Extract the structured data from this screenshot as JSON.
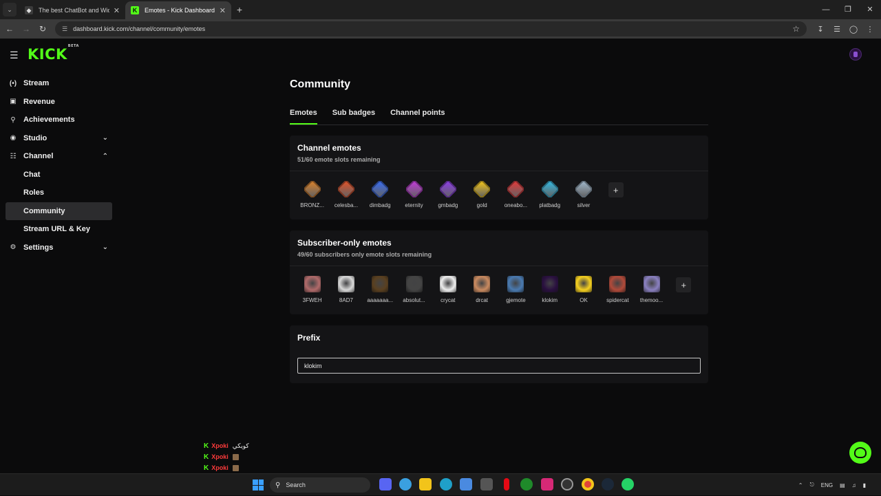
{
  "browser": {
    "tabs": [
      {
        "title": "The best ChatBot and Widgets",
        "active": false
      },
      {
        "title": "Emotes - Kick Dashboard",
        "active": true
      }
    ],
    "url": "dashboard.kick.com/channel/community/emotes"
  },
  "app": {
    "logo": "KICK",
    "logo_badge": "BETA"
  },
  "sidebar": {
    "items": [
      {
        "label": "Stream",
        "icon": "broadcast-icon"
      },
      {
        "label": "Revenue",
        "icon": "revenue-icon"
      },
      {
        "label": "Achievements",
        "icon": "trophy-icon"
      },
      {
        "label": "Studio",
        "icon": "studio-icon"
      },
      {
        "label": "Channel",
        "icon": "channel-icon"
      },
      {
        "label": "Chat"
      },
      {
        "label": "Roles"
      },
      {
        "label": "Community"
      },
      {
        "label": "Stream URL & Key"
      },
      {
        "label": "Settings",
        "icon": "gear-icon"
      }
    ]
  },
  "main": {
    "title": "Community",
    "tabs": [
      {
        "label": "Emotes"
      },
      {
        "label": "Sub badges"
      },
      {
        "label": "Channel points"
      }
    ],
    "channel_emotes": {
      "title": "Channel emotes",
      "subtitle": "51/60 emote slots remaining",
      "emotes": [
        {
          "name": "BRONZ...",
          "color": "#d9822b"
        },
        {
          "name": "celesba...",
          "color": "#e0532a"
        },
        {
          "name": "dimbadg",
          "color": "#3a6df0"
        },
        {
          "name": "eternity",
          "color": "#c13bd8"
        },
        {
          "name": "gmbadg",
          "color": "#8d3ee6"
        },
        {
          "name": "gold",
          "color": "#f2c41a"
        },
        {
          "name": "oneabo...",
          "color": "#e23a3a"
        },
        {
          "name": "platbadg",
          "color": "#35b8e0"
        },
        {
          "name": "silver",
          "color": "#9fb6c9"
        }
      ]
    },
    "subscriber_emotes": {
      "title": "Subscriber-only emotes",
      "subtitle": "49/60 subscribers only emote slots remaining",
      "emotes": [
        {
          "name": "3FWEH",
          "color": "#b06a6a"
        },
        {
          "name": "8AD7",
          "color": "#d8d8d8"
        },
        {
          "name": "aaaaaaa...",
          "color": "#5a4020"
        },
        {
          "name": "absolut...",
          "color": "#444444"
        },
        {
          "name": "crycat",
          "color": "#eeeeee"
        },
        {
          "name": "drcat",
          "color": "#c98a60"
        },
        {
          "name": "gjemote",
          "color": "#4a7ab0"
        },
        {
          "name": "klokim",
          "color": "#2a1040"
        },
        {
          "name": "OK",
          "color": "#f5d020"
        },
        {
          "name": "spidercat",
          "color": "#b04a3a"
        },
        {
          "name": "themoo...",
          "color": "#8a80c0"
        }
      ]
    },
    "prefix": {
      "title": "Prefix",
      "value": "klokim"
    }
  },
  "chat_overlay": [
    {
      "user": "Xpoki",
      "message": "كويكي"
    },
    {
      "user": "Xpoki",
      "message": ""
    },
    {
      "user": "Xpoki",
      "message": ""
    }
  ],
  "taskbar": {
    "search_label": "Search",
    "language": "ENG"
  }
}
